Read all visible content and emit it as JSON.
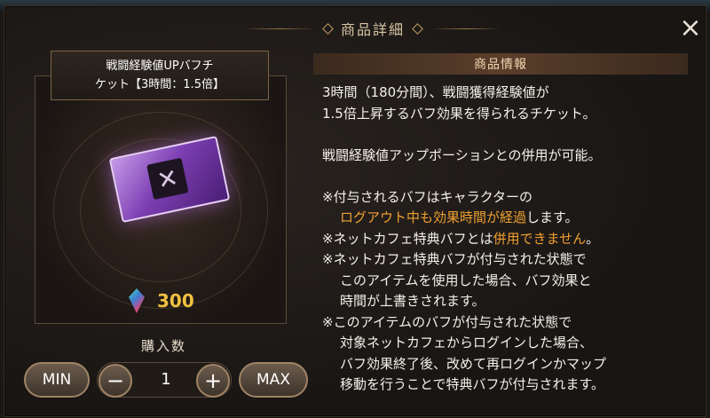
{
  "dialog": {
    "title": "商品詳細",
    "close_label": "×"
  },
  "item": {
    "name_line1": "戦闘経験値UPバフチ",
    "name_line2": "ケット【3時間：1.5倍】",
    "icon": "purple-ticket-icon",
    "price": "300",
    "currency_icon": "gem-icon"
  },
  "quantity": {
    "label": "購入数",
    "min_label": "MIN",
    "max_label": "MAX",
    "minus_label": "−",
    "plus_label": "+",
    "value": "1"
  },
  "info": {
    "header": "商品情報",
    "line1": "3時間（180分間）、戦闘獲得経験値が",
    "line2": "1.5倍上昇するバフ効果を得られるチケット。",
    "line3": "戦闘経験値アップポーションとの併用が可能。",
    "note1_a": "※付与されるバフはキャラクターの",
    "note1_b": "ログアウト中も効果時間が経過",
    "note1_c": "します。",
    "note2_a": "※ネットカフェ特典バフとは",
    "note2_b": "併用できません",
    "note2_c": "。",
    "note3_a": "※ネットカフェ特典バフが付与された状態で",
    "note3_b": "このアイテムを使用した場合、バフ効果と",
    "note3_c": "時間が上書きされます。",
    "note4_a": "※このアイテムのバフが付与された状態で",
    "note4_b": "対象ネットカフェからログインした場合、",
    "note4_c": "バフ効果終了後、改めて再ログインかマップ",
    "note4_d": "移動を行うことで特典バフが付与されます。"
  },
  "colors": {
    "accent_orange": "#f0a030",
    "price_gold": "#f0c040"
  }
}
